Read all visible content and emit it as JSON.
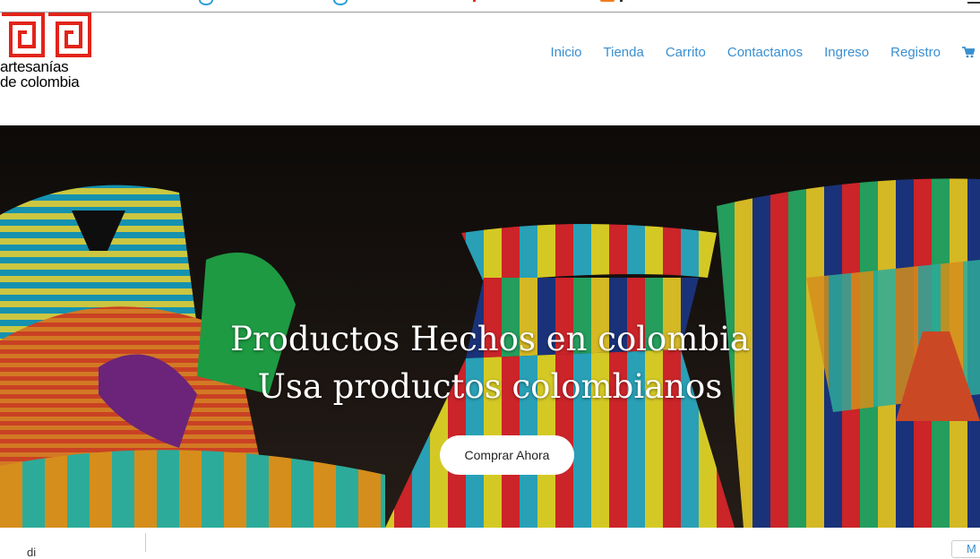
{
  "brand": {
    "line1": "artesanías",
    "line2": "de colombia",
    "color": "#e2231a"
  },
  "nav": {
    "items": [
      {
        "label": "Inicio"
      },
      {
        "label": "Tienda"
      },
      {
        "label": "Carrito"
      },
      {
        "label": "Contactanos"
      },
      {
        "label": "Ingreso"
      },
      {
        "label": "Registro"
      }
    ],
    "cart_icon": "shopping-cart-icon",
    "link_color": "#3a8fd0"
  },
  "hero": {
    "title_line1": "Productos Hechos en colombia",
    "title_line2": "Usa productos colombianos",
    "cta_label": "Comprar Ahora"
  },
  "footer_fragment": {
    "left_label": "di",
    "right_label": "M"
  }
}
